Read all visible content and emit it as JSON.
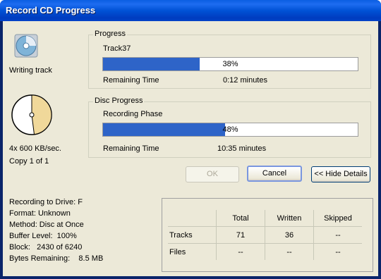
{
  "window": {
    "title": "Record CD Progress"
  },
  "left": {
    "status_label": "Writing track",
    "speed": "4x 600 KB/sec.",
    "copy": "Copy 1 of 1"
  },
  "progress": {
    "group_title": "Progress",
    "item": "Track37",
    "percent": 38,
    "percent_label": "38%",
    "remaining_label": "Remaining Time",
    "remaining_value": "0:12 minutes"
  },
  "disc_progress": {
    "group_title": "Disc Progress",
    "item": "Recording Phase",
    "percent": 48,
    "percent_label": "48%",
    "remaining_label": "Remaining Time",
    "remaining_value": "10:35 minutes"
  },
  "buttons": {
    "ok": "OK",
    "cancel": "Cancel",
    "hide_details": "<< Hide Details"
  },
  "details": [
    "Recording to Drive: F",
    "Format: Unknown",
    "Method: Disc at Once",
    "Buffer Level:  100%",
    "Block:   2430 of 6240",
    "Bytes Remaining:    8.5 MB"
  ],
  "stats": {
    "headers": [
      "Total",
      "Written",
      "Skipped"
    ],
    "rows": [
      {
        "label": "Tracks",
        "values": [
          "71",
          "36",
          "--"
        ]
      },
      {
        "label": "Files",
        "values": [
          "--",
          "--",
          "--"
        ]
      }
    ]
  },
  "colors": {
    "progress_fill": "#2e64c8",
    "titlebar": "#0054e3",
    "dialog_bg": "#ece9d8",
    "pie_fill": "#f0d89a"
  },
  "icons": {
    "cd": "cd-disc-icon",
    "pie": "disc-progress-pie-icon"
  }
}
